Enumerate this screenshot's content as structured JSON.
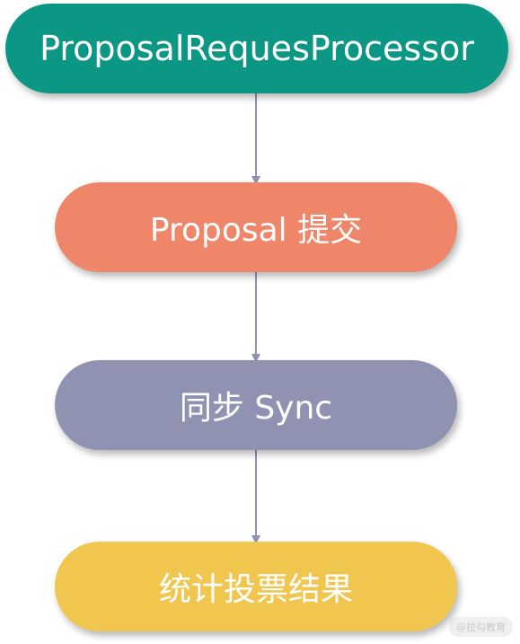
{
  "nodes": [
    {
      "label": "ProposalRequesProcessor",
      "color": "#0b9784"
    },
    {
      "label": "Proposal 提交",
      "color": "#ef8669"
    },
    {
      "label": "同步 Sync",
      "color": "#8f93b1"
    },
    {
      "label": "统计投票结果",
      "color": "#f0c64e"
    }
  ],
  "connector_color": "#8f93b1",
  "watermark": "@拉勾教育"
}
